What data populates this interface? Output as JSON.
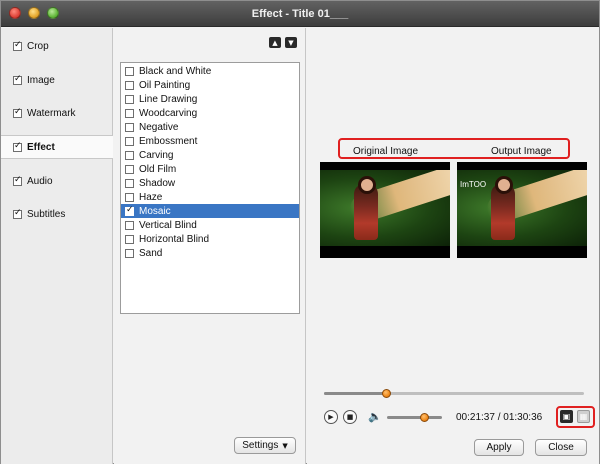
{
  "window": {
    "title": "Effect - Title 01___"
  },
  "sidebar": {
    "items": [
      {
        "label": "Crop",
        "checked": true
      },
      {
        "label": "Image",
        "checked": true
      },
      {
        "label": "Watermark",
        "checked": true
      },
      {
        "label": "Effect",
        "checked": true,
        "active": true
      },
      {
        "label": "Audio",
        "checked": true
      },
      {
        "label": "Subtitles",
        "checked": true
      }
    ]
  },
  "effects": {
    "items": [
      {
        "label": "Black and White",
        "checked": false
      },
      {
        "label": "Oil Painting",
        "checked": false
      },
      {
        "label": "Line Drawing",
        "checked": false
      },
      {
        "label": "Woodcarving",
        "checked": false
      },
      {
        "label": "Negative",
        "checked": false
      },
      {
        "label": "Embossment",
        "checked": false
      },
      {
        "label": "Carving",
        "checked": false
      },
      {
        "label": "Old Film",
        "checked": false
      },
      {
        "label": "Shadow",
        "checked": false
      },
      {
        "label": "Haze",
        "checked": false
      },
      {
        "label": "Mosaic",
        "checked": true,
        "selected": true
      },
      {
        "label": "Vertical Blind",
        "checked": false
      },
      {
        "label": "Horizontal Blind",
        "checked": false
      },
      {
        "label": "Sand",
        "checked": false
      }
    ],
    "move_up_icon": "triangle-up-icon",
    "move_down_icon": "triangle-down-icon",
    "settings_label": "Settings"
  },
  "preview": {
    "original_label": "Original Image",
    "output_label": "Output Image",
    "watermark_text": "ImTOO",
    "seek_progress": 0.24,
    "volume_level": 0.68,
    "current_time": "00:21:37",
    "time_separator": "/",
    "total_time": "01:30:36"
  },
  "colors": {
    "accent_select": "#3a76c4",
    "highlight_red": "#e02020",
    "knob_orange": "#f08a1a"
  },
  "footer": {
    "apply_label": "Apply",
    "close_label": "Close"
  }
}
